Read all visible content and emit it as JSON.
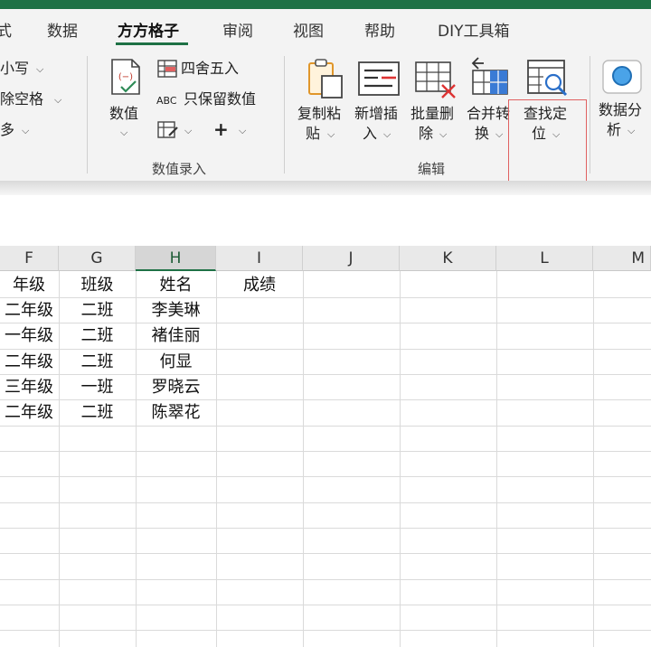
{
  "tabs": [
    "式",
    "数据",
    "方方格子",
    "审阅",
    "视图",
    "帮助",
    "DIY工具箱"
  ],
  "ribbon": {
    "left_items": [
      "小写",
      "除空格",
      "多"
    ],
    "shuzhi_label": "数值",
    "sishewuru": "四舍五入",
    "abc": "ABC",
    "zhibaoliu": "只保留数值",
    "plus": "+",
    "group_shuzhi": "数值录入",
    "fuzhi_line1": "复制粘",
    "fuzhi_line2": "贴",
    "xinzeng_line1": "新增插",
    "xinzeng_line2": "入",
    "piliang_line1": "批量删",
    "piliang_line2": "除",
    "hebing_line1": "合并转",
    "hebing_line2": "换",
    "chazhao_line1": "查找定",
    "chazhao_line2": "位",
    "shujufen_line1": "数据分",
    "shujufen_line2": "析",
    "group_bianji": "编辑"
  },
  "columns": [
    "F",
    "G",
    "H",
    "I",
    "J",
    "K",
    "L",
    "M"
  ],
  "sheet": {
    "headers": [
      "年级",
      "班级",
      "姓名",
      "成绩"
    ],
    "rows": [
      [
        "二年级",
        "二班",
        "李美琳",
        ""
      ],
      [
        "一年级",
        "二班",
        "褚佳丽",
        ""
      ],
      [
        "二年级",
        "二班",
        "何显",
        ""
      ],
      [
        "三年级",
        "一班",
        "罗晓云",
        ""
      ],
      [
        "二年级",
        "二班",
        "陈翠花",
        ""
      ]
    ]
  },
  "colors": {
    "excel_green": "#1e7145",
    "highlight_red": "#e06060"
  }
}
